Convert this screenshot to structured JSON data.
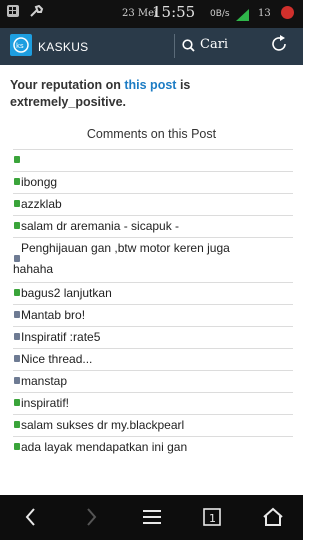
{
  "status_bar": {
    "date": "23 Mei",
    "time": "15:55",
    "speed": "0B/s",
    "battery_level": "13"
  },
  "header": {
    "brand": "KASKUS",
    "search_label": "Cari"
  },
  "reputation": {
    "prefix": "Your reputation on",
    "link": "this post",
    "suffix": "is extremely_positive."
  },
  "comments_title": "Comments on this Post",
  "comments": [
    {
      "text": "",
      "color": "green"
    },
    {
      "text": "ibongg",
      "color": "green"
    },
    {
      "text": "azzklab",
      "color": "green"
    },
    {
      "text": "salam dr aremania - sicapuk -",
      "color": "green"
    },
    {
      "text": "Penghijauan gan ,btw motor keren juga",
      "text2": "hahaha",
      "color": "blue"
    },
    {
      "text": "bagus2 lanjutkan",
      "color": "green"
    },
    {
      "text": "Mantab bro!",
      "color": "blue"
    },
    {
      "text": "Inspiratif :rate5",
      "color": "blue"
    },
    {
      "text": "Nice thread...",
      "color": "blue"
    },
    {
      "text": "manstap",
      "color": "blue"
    },
    {
      "text": "inspiratif!",
      "color": "green"
    },
    {
      "text": "salam sukses dr my.blackpearl",
      "color": "green"
    },
    {
      "text": "ada layak mendapatkan ini gan",
      "color": "green"
    }
  ],
  "bottom_nav": {
    "tabs_count": "1"
  },
  "colors": {
    "header_bg": "#2a3a49",
    "logo_bg": "#1e9ee0",
    "link": "#1c7cc4",
    "green_dot": "#3aa43a",
    "blue_dot": "#6e7b93"
  },
  "icons": [
    "bbm-icon",
    "wrench-icon",
    "signal-icon",
    "record-icon",
    "kaskus-logo-icon",
    "search-icon",
    "refresh-icon",
    "back-icon",
    "forward-icon",
    "menu-icon",
    "tabs-icon",
    "home-icon"
  ]
}
